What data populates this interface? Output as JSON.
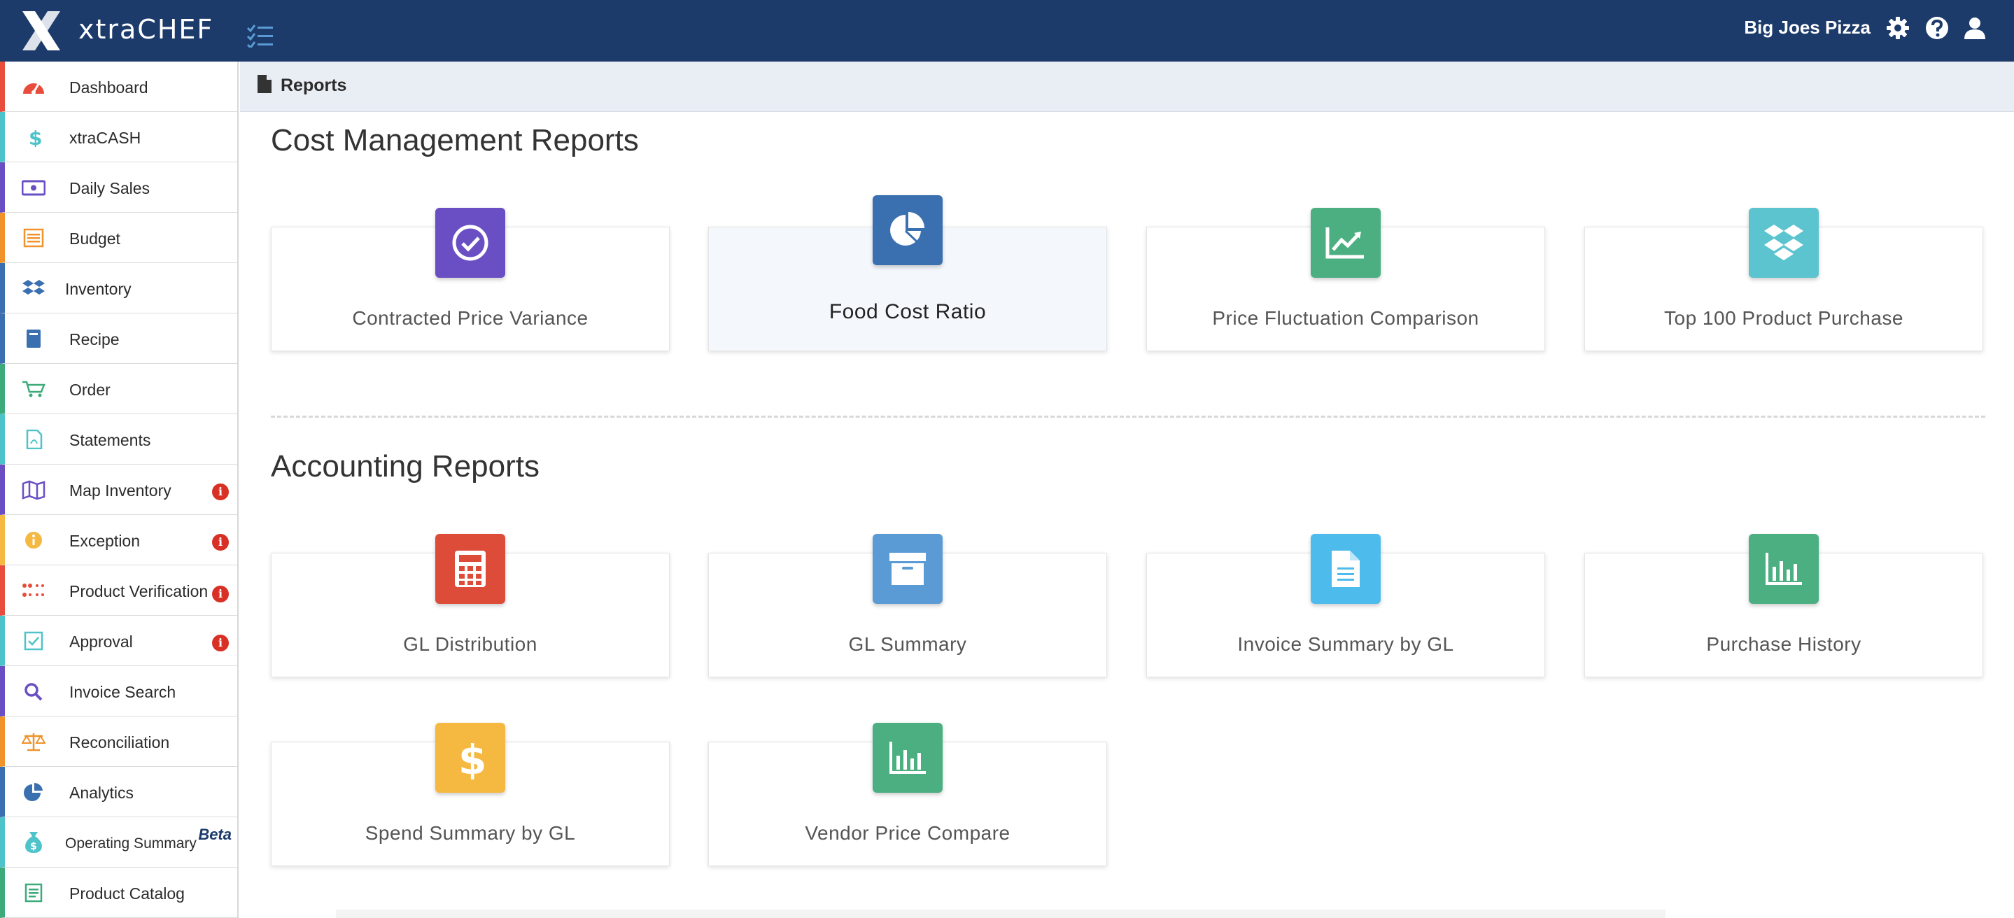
{
  "header": {
    "brand": "xtraCHEF",
    "account_name": "Big Joes Pizza",
    "icons": [
      "logo-x-icon",
      "tasks-icon",
      "gear-icon",
      "help-icon",
      "user-icon"
    ],
    "background": "#1c3b6b"
  },
  "sidebar": {
    "items": [
      {
        "label": "Dashboard",
        "icon": "speedometer-icon",
        "color": "#e74c3c",
        "alert": ""
      },
      {
        "label": "xtraCASH",
        "icon": "dollar-icon",
        "color": "#4ec3c9",
        "alert": ""
      },
      {
        "label": "Daily Sales",
        "icon": "money-icon",
        "color": "#6a4fc4",
        "alert": ""
      },
      {
        "label": "Budget",
        "icon": "list-icon",
        "color": "#f0932b",
        "alert": ""
      },
      {
        "label": "Inventory",
        "icon": "boxes-icon",
        "color": "#3a6fb0",
        "alert": ""
      },
      {
        "label": "Recipe",
        "icon": "book-icon",
        "color": "#3a6fb0",
        "alert": ""
      },
      {
        "label": "Order",
        "icon": "cart-icon",
        "color": "#3daa7a",
        "alert": ""
      },
      {
        "label": "Statements",
        "icon": "pdf-icon",
        "color": "#4ec3c9",
        "alert": ""
      },
      {
        "label": "Map Inventory",
        "icon": "map-icon",
        "color": "#6a4fc4",
        "alert": "i"
      },
      {
        "label": "Exception",
        "icon": "info-icon",
        "color": "#f5b942",
        "alert": "i"
      },
      {
        "label": "Product Verification",
        "icon": "dots-icon",
        "color": "#e74c3c",
        "alert": "i"
      },
      {
        "label": "Approval",
        "icon": "check-square-icon",
        "color": "#4ec3c9",
        "alert": "i"
      },
      {
        "label": "Invoice Search",
        "icon": "search-icon",
        "color": "#6a4fc4",
        "alert": ""
      },
      {
        "label": "Reconciliation",
        "icon": "scale-icon",
        "color": "#f0932b",
        "alert": ""
      },
      {
        "label": "Analytics",
        "icon": "pie-icon",
        "color": "#3a6fb0",
        "alert": ""
      },
      {
        "label": "Operating Summary",
        "icon": "money-bag-icon",
        "color": "#4ec3c9",
        "alert": "",
        "badge": "Beta"
      },
      {
        "label": "Product Catalog",
        "icon": "catalog-icon",
        "color": "#3daa7a",
        "alert": ""
      }
    ]
  },
  "breadcrumb": {
    "label": "Reports",
    "icon": "file-icon"
  },
  "sections": {
    "cost": {
      "title": "Cost Management Reports",
      "cards": [
        {
          "label": "Contracted Price Variance",
          "icon": "check-circle-icon",
          "color": "#6a4fc4"
        },
        {
          "label": "Food Cost Ratio",
          "icon": "pie-chart-icon",
          "color": "#3a6fb0"
        },
        {
          "label": "Price Fluctuation Comparison",
          "icon": "line-chart-icon",
          "color": "#4caf82"
        },
        {
          "label": "Top 100 Product Purchase",
          "icon": "dropbox-icon",
          "color": "#5bc4cf"
        }
      ]
    },
    "accounting": {
      "title": "Accounting Reports",
      "cards": [
        {
          "label": "GL Distribution",
          "icon": "calculator-icon",
          "color": "#dd4b39"
        },
        {
          "label": "GL Summary",
          "icon": "archive-icon",
          "color": "#5b9bd5"
        },
        {
          "label": "Invoice Summary by GL",
          "icon": "document-icon",
          "color": "#4dbcec"
        },
        {
          "label": "Purchase History",
          "icon": "bar-chart-icon",
          "color": "#4caf82"
        },
        {
          "label": "Spend Summary by GL",
          "icon": "dollar-sign-icon",
          "color": "#f5b942"
        },
        {
          "label": "Vendor Price Compare",
          "icon": "bar-chart-icon",
          "color": "#4caf82"
        }
      ]
    }
  }
}
